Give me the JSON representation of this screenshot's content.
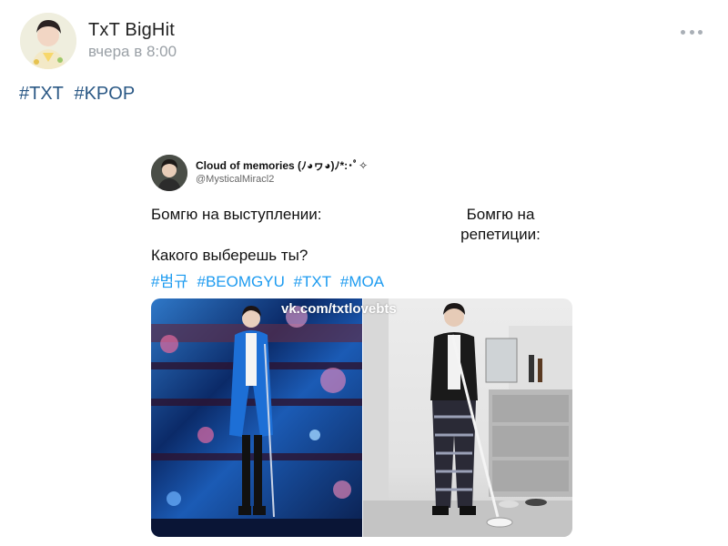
{
  "post": {
    "author": "TxT BigHit",
    "time": "вчера в 8:00",
    "hashtags": [
      "#TXT",
      "#KPOP"
    ]
  },
  "embedded_tweet": {
    "display_name": "Cloud of memories (ﾉ◕ヮ◕)ﾉ*:･ﾟ✧",
    "handle": "@MysticalMiracl2",
    "left_caption": "Бомгю на выступлении:",
    "right_caption": "Бомгю на репетиции:",
    "question": "Какого выберешь ты?",
    "hashtags": [
      "#범규",
      "#BEOMGYU",
      "#TXT",
      "#MOA"
    ],
    "watermark": "vk.com/txtlovebts"
  },
  "colors": {
    "link": "#2a5885",
    "twitter_link": "#1d9bf0",
    "muted": "#9aa0a6"
  },
  "icons": [
    "more-icon"
  ]
}
